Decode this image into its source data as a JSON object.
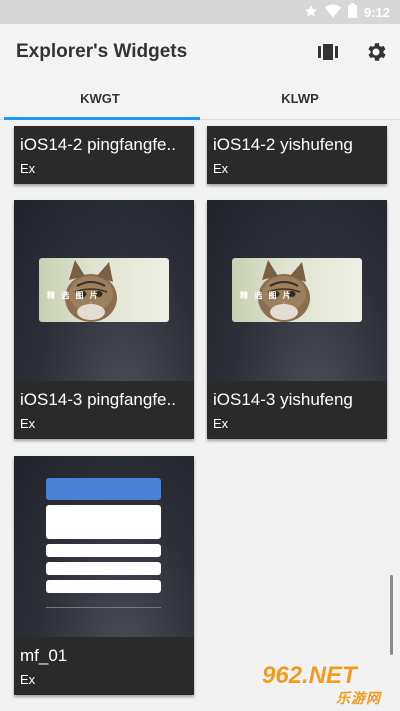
{
  "status_bar": {
    "time": "9:12"
  },
  "app_bar": {
    "title": "Explorer's Widgets"
  },
  "tabs": [
    {
      "label": "KWGT",
      "selected": true
    },
    {
      "label": "KLWP",
      "selected": false
    }
  ],
  "widgets": [
    {
      "title": "iOS14-2 pingfangfe..",
      "author": "Ex"
    },
    {
      "title": "iOS14-2 yishufeng",
      "author": "Ex"
    },
    {
      "title": "iOS14-3 pingfangfe..",
      "author": "Ex",
      "preview_text": "精 选 图 片"
    },
    {
      "title": "iOS14-3 yishufeng",
      "author": "Ex",
      "preview_text": "精 选 图 片"
    },
    {
      "title": "mf_01",
      "author": "Ex"
    }
  ],
  "watermark": {
    "top": "962.NET",
    "bottom": "乐游网"
  },
  "colors": {
    "accent": "#2196f3",
    "card_bg": "#2a2a2a",
    "watermark": "#f39a1f"
  }
}
